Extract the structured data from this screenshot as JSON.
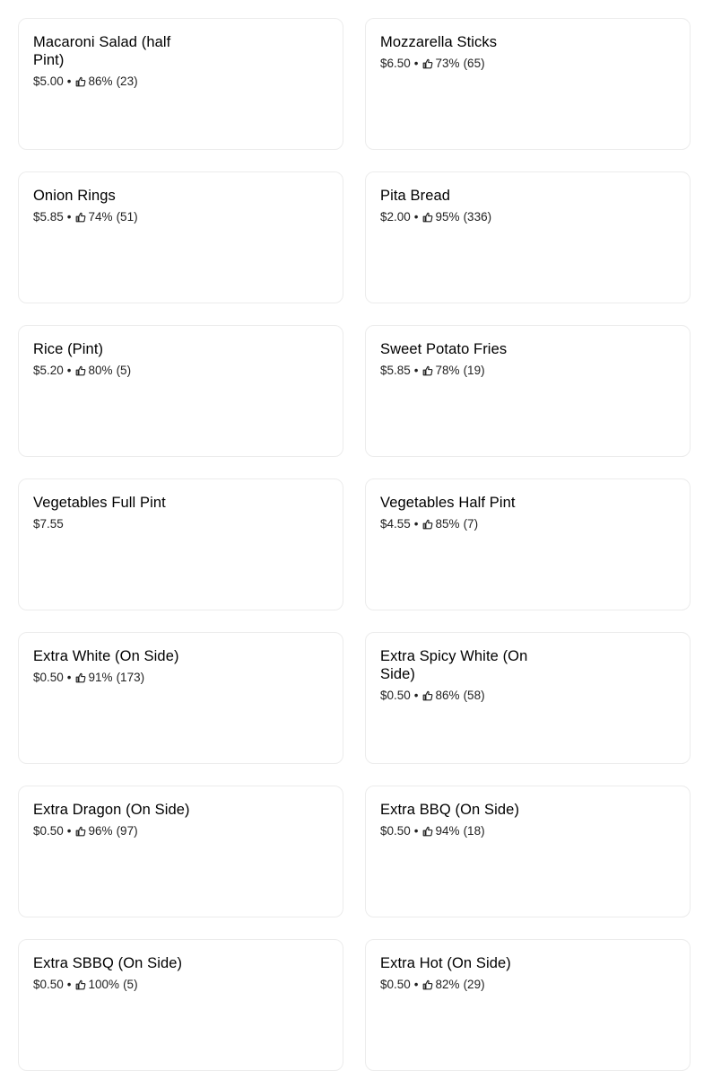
{
  "menu": {
    "items": [
      {
        "name": "Macaroni Salad (half Pint)",
        "price": "$5.00",
        "rating": "86%",
        "count": "(23)",
        "has_rating": true
      },
      {
        "name": "Mozzarella Sticks",
        "price": "$6.50",
        "rating": "73%",
        "count": "(65)",
        "has_rating": true
      },
      {
        "name": "Onion Rings",
        "price": "$5.85",
        "rating": "74%",
        "count": "(51)",
        "has_rating": true
      },
      {
        "name": "Pita Bread",
        "price": "$2.00",
        "rating": "95%",
        "count": "(336)",
        "has_rating": true
      },
      {
        "name": "Rice (Pint)",
        "price": "$5.20",
        "rating": "80%",
        "count": "(5)",
        "has_rating": true
      },
      {
        "name": "Sweet Potato Fries",
        "price": "$5.85",
        "rating": "78%",
        "count": "(19)",
        "has_rating": true
      },
      {
        "name": "Vegetables Full Pint",
        "price": "$7.55",
        "rating": "",
        "count": "",
        "has_rating": false
      },
      {
        "name": "Vegetables Half Pint",
        "price": "$4.55",
        "rating": "85%",
        "count": "(7)",
        "has_rating": true
      },
      {
        "name": "Extra White (On Side)",
        "price": "$0.50",
        "rating": "91%",
        "count": "(173)",
        "has_rating": true
      },
      {
        "name": "Extra Spicy White (On Side)",
        "price": "$0.50",
        "rating": "86%",
        "count": "(58)",
        "has_rating": true
      },
      {
        "name": "Extra Dragon (On Side)",
        "price": "$0.50",
        "rating": "96%",
        "count": "(97)",
        "has_rating": true
      },
      {
        "name": "Extra BBQ (On Side)",
        "price": "$0.50",
        "rating": "94%",
        "count": "(18)",
        "has_rating": true
      },
      {
        "name": "Extra SBBQ (On Side)",
        "price": "$0.50",
        "rating": "100%",
        "count": "(5)",
        "has_rating": true
      },
      {
        "name": "Extra Hot (On Side)",
        "price": "$0.50",
        "rating": "82%",
        "count": "(29)",
        "has_rating": true
      }
    ],
    "separator": "•",
    "rating_icon": "thumbs-up-icon",
    "colors": {
      "card_border": "#ececec",
      "text": "#000000",
      "meta_text": "#222222"
    }
  }
}
